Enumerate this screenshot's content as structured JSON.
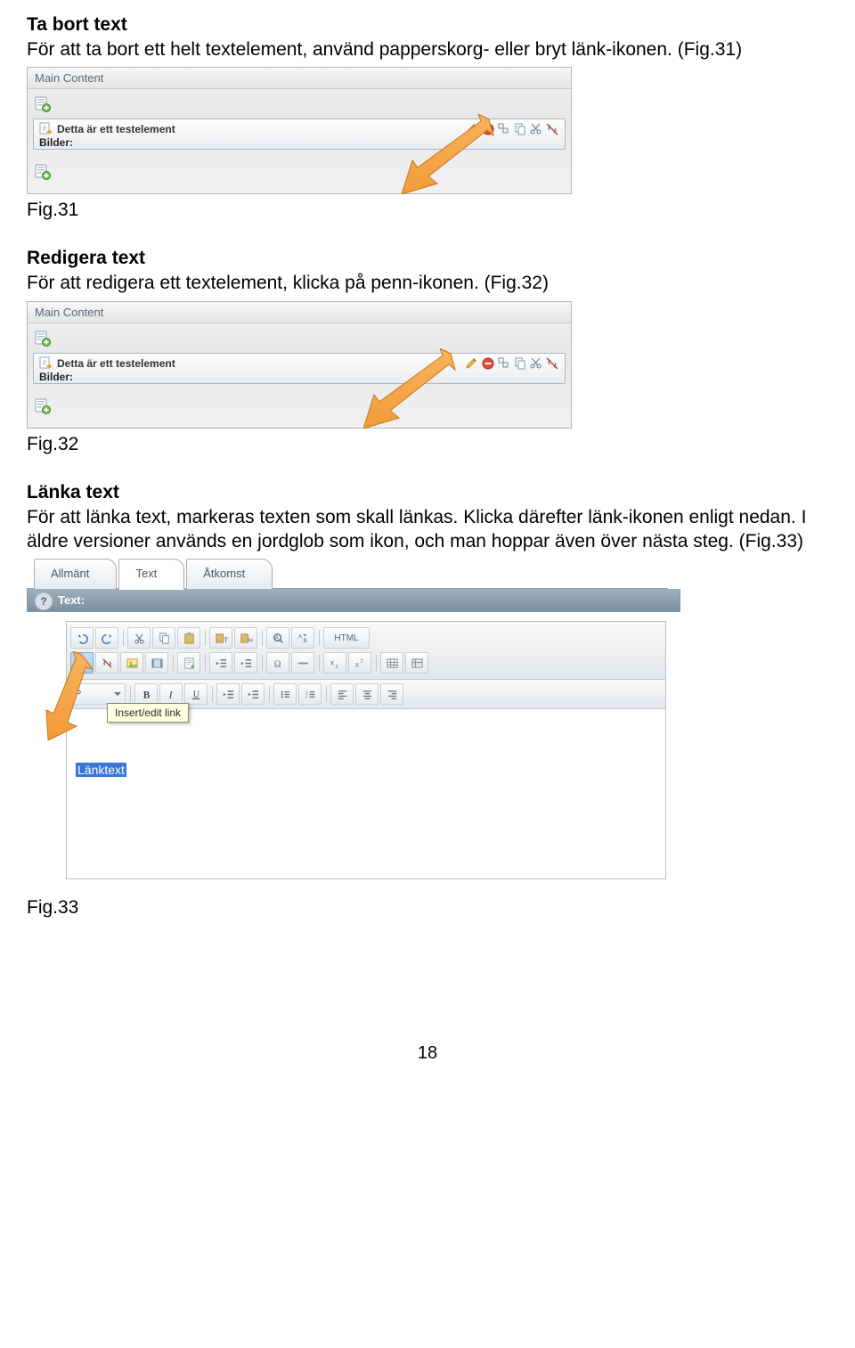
{
  "sections": {
    "remove": {
      "title": "Ta bort text",
      "body": "För att ta bort ett helt textelement, använd papperskorg- eller bryt länk-ikonen. (Fig.31)",
      "caption": "Fig.31"
    },
    "edit": {
      "title": "Redigera text",
      "body": "För att redigera ett textelement, klicka på penn-ikonen. (Fig.32)",
      "caption": "Fig.32"
    },
    "link": {
      "title": "Länka text",
      "body": "För att länka text, markeras texten som skall länkas. Klicka därefter länk-ikonen enligt nedan. I äldre versioner används en jordglob som ikon, och man hoppar även över nästa steg. (Fig.33)",
      "caption": "Fig.33"
    }
  },
  "cms": {
    "header": "Main Content",
    "element_label": "Detta är ett testelement",
    "images_label": "Bilder:",
    "icons": {
      "add": "add-element-icon",
      "doc": "document-with-arrow-icon",
      "pencil": "pencil-icon",
      "trash": "trash-icon",
      "pin": "pin-icon",
      "copy": "copy-icon",
      "cut": "scissors-icon",
      "unlink": "unlink-icon"
    }
  },
  "rte": {
    "tabs": [
      "Allmänt",
      "Text",
      "Åtkomst"
    ],
    "active_tab": 1,
    "section_label": "Text:",
    "tooltip": "Insert/edit link",
    "format_placeholder": "P",
    "html_btn": "HTML",
    "selected_text": "Länktext"
  },
  "page_number": "18"
}
